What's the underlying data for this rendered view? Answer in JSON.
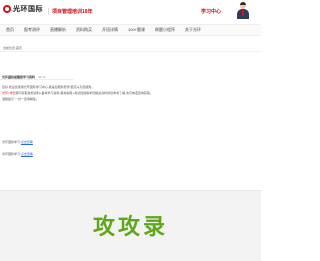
{
  "header": {
    "logo_text": "光环国际",
    "logo_sub": "GUANG HUAN GUO JI",
    "slogan": "项目管理培训18年",
    "study_center": "学习中心"
  },
  "nav": {
    "items": [
      "首页",
      "报考测评",
      "直播解析",
      "资料购买",
      "开班详情",
      "100+题课",
      "刷题小程序",
      "关于光环"
    ]
  },
  "breadcrumb": "当前位置:首页",
  "panel": {
    "title": "光环国际提醒您学习资料",
    "date": "06-19",
    "lines": [
      {
        "prefix": "您好,",
        "red": "",
        "text": "欢迎您使用光环国际学习中心,我是您服务老师,很高兴为您服务。"
      },
      {
        "prefix": "",
        "red": "光环×学员",
        "text": "即可获取免费资料+备考学习资料,报考指南+考试经验等学员相关资料供您参考了解,也可电话咨询获取。"
      },
      {
        "prefix": "",
        "red": "",
        "text": "温馨提示,一对一咨询解答。"
      }
    ],
    "sign_1": {
      "label": "光环国际学习:",
      "link": "点击查看"
    },
    "sign_2": {
      "label": "光环国际学习:",
      "link": "点击查看"
    }
  },
  "footer": {
    "watermark": "攻攻录"
  }
}
